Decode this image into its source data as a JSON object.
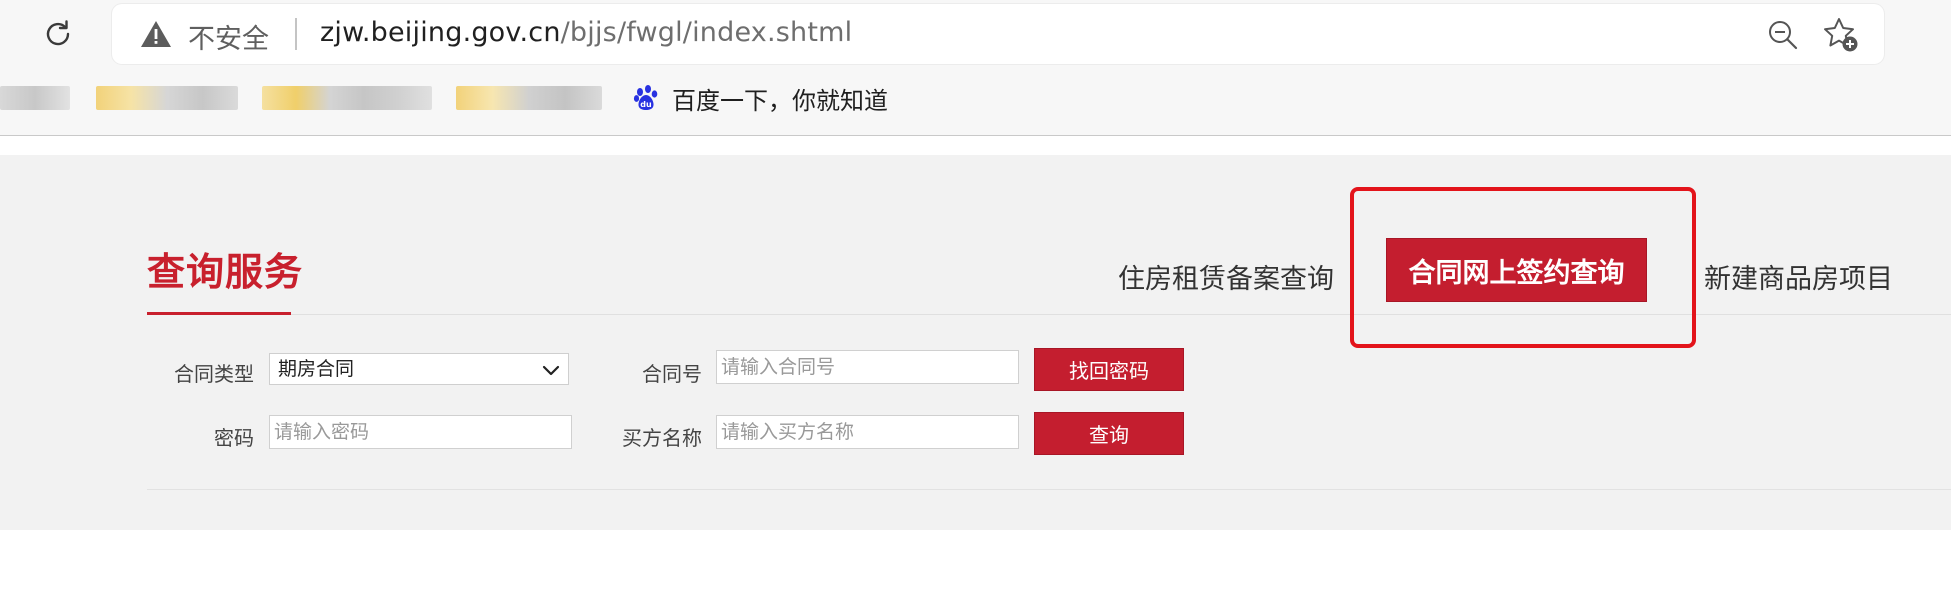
{
  "browser": {
    "insecure_label": "不安全",
    "url_host": "zjw.beijing.gov.cn",
    "url_path": "/bjjs/fwgl/index.shtml",
    "bookmark_baidu": "百度一下，你就知道"
  },
  "page": {
    "section_title": "查询服务",
    "tabs": [
      {
        "label": "住房租赁备案查询"
      },
      {
        "label": "合同网上签约查询",
        "active": true
      },
      {
        "label": "新建商品房项目"
      }
    ]
  },
  "form": {
    "contract_type_label": "合同类型",
    "contract_type_value": "期房合同",
    "contract_no_label": "合同号",
    "contract_no_placeholder": "请输入合同号",
    "recover_button": "找回密码",
    "password_label": "密码",
    "password_placeholder": "请输入密码",
    "buyer_label": "买方名称",
    "buyer_placeholder": "请输入买方名称",
    "query_button": "查询"
  },
  "colors": {
    "accent": "#c41e2f",
    "highlight": "#e3141b"
  }
}
